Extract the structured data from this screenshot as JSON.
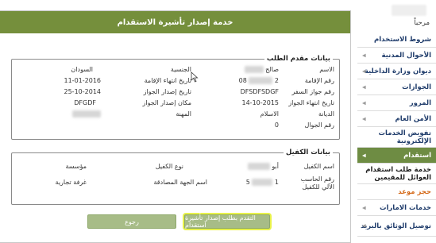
{
  "sidebar": {
    "greeting": "مرحباً",
    "items": [
      {
        "label": "شروط الاستخدام",
        "arrow": false,
        "state": "normal"
      },
      {
        "label": "الأحوال المدنية",
        "arrow": true,
        "state": "normal"
      },
      {
        "label": "ديوان وزارة الداخلية",
        "arrow": true,
        "state": "normal"
      },
      {
        "label": "الجوازات",
        "arrow": true,
        "state": "normal"
      },
      {
        "label": "المرور",
        "arrow": true,
        "state": "normal"
      },
      {
        "label": "الأمن العام",
        "arrow": true,
        "state": "normal"
      },
      {
        "label": "تفويض الخدمات الإلكترونية",
        "arrow": false,
        "state": "normal"
      },
      {
        "label": "استقدام",
        "arrow": true,
        "state": "active"
      },
      {
        "label": "خدمة طلب استقدام العوائل للمقيمين",
        "arrow": false,
        "state": "sub"
      },
      {
        "label": "حجز موعد",
        "arrow": false,
        "state": "orange"
      },
      {
        "label": "خدمات الامارات",
        "arrow": true,
        "state": "normal"
      },
      {
        "label": "توصيل الوثائق بالبريد",
        "arrow": true,
        "state": "normal"
      }
    ]
  },
  "panel": {
    "title": "خدمة إصدار تأشيرة الاستقدام",
    "applicant": {
      "legend": "بيانات مقدم الطلب",
      "fields": {
        "name_label": "الاسم",
        "name_value": "صالح",
        "nationality_label": "الجنسية",
        "nationality_value": "السودان",
        "iqama_label": "رقم الإقامة",
        "iqama_value": "2",
        "iqama_value_end": "08",
        "iqama_expiry_label": "تاريخ انتهاء الإقامة",
        "iqama_expiry_value": "11-01-2016",
        "passport_label": "رقم جواز السفر",
        "passport_value": "DFSDFSDGF",
        "passport_issue_label": "تاريخ إصدار الجواز",
        "passport_issue_value": "25-10-2014",
        "passport_expiry_label": "تاريخ انتهاء الجواز",
        "passport_expiry_value": "14-10-2015",
        "passport_place_label": "مكان إصدار الجواز",
        "passport_place_value": "DFGDF",
        "religion_label": "الديانة",
        "religion_value": "الاسلام",
        "profession_label": "المهنة",
        "mobile_label": "رقم الجوال",
        "mobile_value": "0"
      }
    },
    "sponsor": {
      "legend": "بيانات الكفيل",
      "fields": {
        "name_label": "اسم الكفيل",
        "name_value": "أبو",
        "type_label": "نوع الكفيل",
        "type_value": "مؤسسة",
        "computer_no_label": "رقم الحاسب الآلي للكفيل",
        "computer_no_value_start": "1",
        "computer_no_value_end": "5",
        "approving_party_label": "اسم الجهة المصادقة",
        "approving_party_value": "غرفة تجارية"
      }
    },
    "buttons": {
      "submit": "التقدم بطلب إصدار تأشيرة استقدام",
      "back": "رجوع"
    }
  }
}
